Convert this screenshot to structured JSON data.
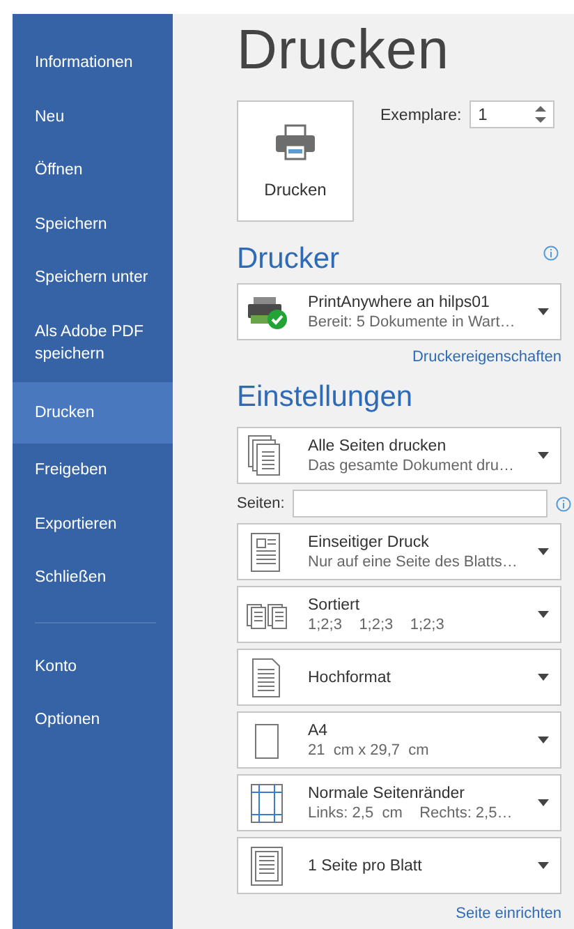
{
  "sidebar": {
    "items": [
      {
        "label": "Informationen",
        "selected": false
      },
      {
        "label": "Neu",
        "selected": false
      },
      {
        "label": "Öffnen",
        "selected": false
      },
      {
        "label": "Speichern",
        "selected": false
      },
      {
        "label": "Speichern unter",
        "selected": false
      },
      {
        "label": "Als Adobe PDF speichern",
        "selected": false
      },
      {
        "label": "Drucken",
        "selected": true
      },
      {
        "label": "Freigeben",
        "selected": false
      },
      {
        "label": "Exportieren",
        "selected": false
      },
      {
        "label": "Schließen",
        "selected": false
      }
    ],
    "bottom_items": [
      {
        "label": "Konto",
        "selected": false
      },
      {
        "label": "Optionen",
        "selected": false
      }
    ]
  },
  "title": "Drucken",
  "print_button": {
    "label": "Drucken"
  },
  "copies": {
    "label": "Exemplare:",
    "value": "1"
  },
  "printer": {
    "heading": "Drucker",
    "name": "PrintAnywhere an hilps01",
    "status": "Bereit: 5 Dokumente in Wart…",
    "link": "Druckereigenschaften"
  },
  "settings": {
    "heading": "Einstellungen",
    "pages_label": "Seiten:",
    "link": "Seite einrichten",
    "dropdowns": [
      {
        "kind": "pages",
        "title": "Alle Seiten drucken",
        "subtitle": "Das gesamte Dokument dru…"
      },
      {
        "kind": "sides",
        "title": "Einseitiger Druck",
        "subtitle": "Nur auf eine Seite des Blatts…"
      },
      {
        "kind": "collate",
        "title": "Sortiert",
        "subtitle": "1;2;3    1;2;3    1;2;3"
      },
      {
        "kind": "orientation",
        "title": "Hochformat"
      },
      {
        "kind": "paper",
        "title": "A4",
        "subtitle": "21  cm x 29,7  cm"
      },
      {
        "kind": "margins",
        "title": "Normale Seitenränder",
        "subtitle": "Links: 2,5  cm    Rechts: 2,5…"
      },
      {
        "kind": "persheet",
        "title": "1 Seite pro Blatt"
      }
    ]
  }
}
